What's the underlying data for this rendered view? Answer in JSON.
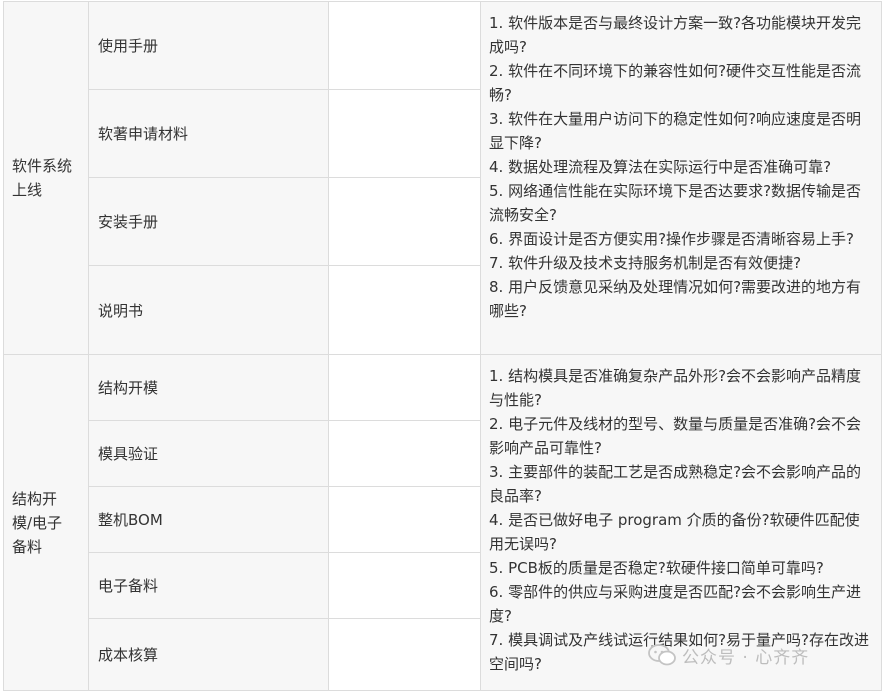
{
  "sections": [
    {
      "category": "软件系统上线",
      "category_lines": [
        "软件系统",
        "上线"
      ],
      "items": [
        "使用手册",
        "软著申请材料",
        "安装手册",
        "说明书"
      ],
      "questions": [
        "1. 软件版本是否与最终设计方案一致?各功能模块开发完成吗?",
        "2. 软件在不同环境下的兼容性如何?硬件交互性能是否流畅?",
        "3. 软件在大量用户访问下的稳定性如何?响应速度是否明显下降?",
        "4. 数据处理流程及算法在实际运行中是否准确可靠?",
        "5. 网络通信性能在实际环境下是否达要求?数据传输是否流畅安全?",
        "6. 界面设计是否方便实用?操作步骤是否清晰容易上手?",
        "7. 软件升级及技术支持服务机制是否有效便捷?",
        "8. 用户反馈意见采纳及处理情况如何?需要改进的地方有哪些?"
      ]
    },
    {
      "category": "结构开模/电子备料",
      "category_lines": [
        "结构开",
        "模/电子",
        "备料"
      ],
      "items": [
        "结构开模",
        "模具验证",
        "整机BOM",
        "电子备料",
        "成本核算"
      ],
      "questions": [
        "1. 结构模具是否准确复杂产品外形?会不会影响产品精度与性能?",
        "2. 电子元件及线材的型号、数量与质量是否准确?会不会影响产品可靠性?",
        "3. 主要部件的装配工艺是否成熟稳定?会不会影响产品的良品率?",
        "4. 是否已做好电子 program 介质的备份?软硬件匹配使用无误吗?",
        "5. PCB板的质量是否稳定?软硬件接口简单可靠吗?",
        "6. 零部件的供应与采购进度是否匹配?会不会影响生产进度?",
        "7. 模具调试及产线试运行结果如何?易于量产吗?存在改进空间吗?"
      ]
    }
  ],
  "watermark": {
    "text": "公众号 · 心齐齐",
    "icon": "wechat-icon"
  }
}
